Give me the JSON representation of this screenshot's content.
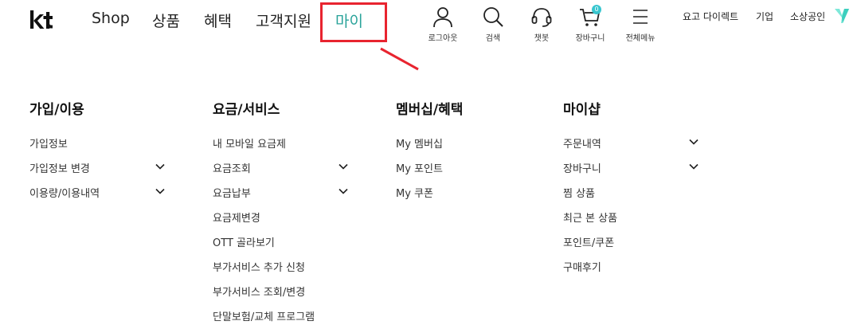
{
  "brand": {
    "logo_text": "kt"
  },
  "nav": {
    "items": [
      {
        "label": "Shop"
      },
      {
        "label": "상품"
      },
      {
        "label": "혜택"
      },
      {
        "label": "고객지원"
      },
      {
        "label": "마이"
      }
    ]
  },
  "utilities": {
    "logout": {
      "label": "로그아웃",
      "icon": "user-icon"
    },
    "search": {
      "label": "검색",
      "icon": "search-icon"
    },
    "chatbot": {
      "label": "챗봇",
      "icon": "headset-icon"
    },
    "cart": {
      "label": "장바구니",
      "icon": "cart-icon",
      "count": "0"
    },
    "all_menu": {
      "label": "전체메뉴",
      "icon": "menu-icon"
    }
  },
  "right_links": [
    "요고 다이렉트",
    "기업",
    "소상공인"
  ],
  "colors": {
    "active_nav": "#2aa39a",
    "highlight": "#e8242f",
    "badge": "#38c6cf",
    "y_logo": "#7ee8d9"
  },
  "menu": {
    "columns": [
      {
        "title": "가입/이용",
        "items": [
          {
            "label": "가입정보",
            "expandable": false
          },
          {
            "label": "가입정보 변경",
            "expandable": true
          },
          {
            "label": "이용량/이용내역",
            "expandable": true
          }
        ]
      },
      {
        "title": "요금/서비스",
        "items": [
          {
            "label": "내 모바일 요금제",
            "expandable": false
          },
          {
            "label": "요금조회",
            "expandable": true
          },
          {
            "label": "요금납부",
            "expandable": true
          },
          {
            "label": "요금제변경",
            "expandable": false
          },
          {
            "label": "OTT 골라보기",
            "expandable": false
          },
          {
            "label": "부가서비스 추가 신청",
            "expandable": false
          },
          {
            "label": "부가서비스 조회/변경",
            "expandable": false
          },
          {
            "label": "단말보험/교체 프로그램",
            "expandable": false
          }
        ]
      },
      {
        "title": "멤버십/혜택",
        "items": [
          {
            "label": "My 멤버십",
            "expandable": false
          },
          {
            "label": "My 포인트",
            "expandable": false
          },
          {
            "label": "My 쿠폰",
            "expandable": false
          }
        ]
      },
      {
        "title": "마이샵",
        "items": [
          {
            "label": "주문내역",
            "expandable": true
          },
          {
            "label": "장바구니",
            "expandable": true
          },
          {
            "label": "찜 상품",
            "expandable": false
          },
          {
            "label": "최근 본 상품",
            "expandable": false
          },
          {
            "label": "포인트/쿠폰",
            "expandable": false
          },
          {
            "label": "구매후기",
            "expandable": false
          }
        ]
      }
    ]
  }
}
